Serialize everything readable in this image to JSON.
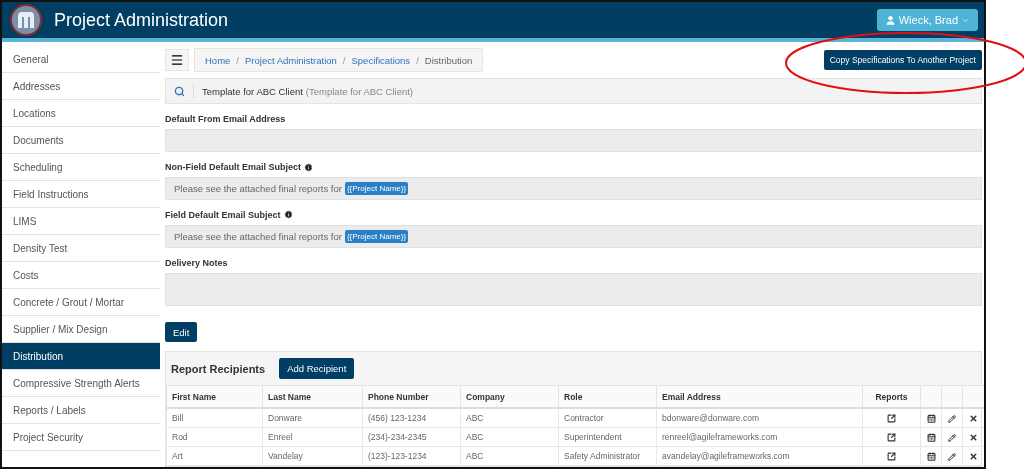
{
  "header": {
    "title": "Project Administration",
    "user_menu": "Wieck, Brad"
  },
  "sidebar": {
    "items": [
      {
        "label": "General",
        "selected": false
      },
      {
        "label": "Addresses",
        "selected": false
      },
      {
        "label": "Locations",
        "selected": false
      },
      {
        "label": "Documents",
        "selected": false
      },
      {
        "label": "Scheduling",
        "selected": false
      },
      {
        "label": "Field Instructions",
        "selected": false
      },
      {
        "label": "LIMS",
        "selected": false
      },
      {
        "label": "Density Test",
        "selected": false
      },
      {
        "label": "Costs",
        "selected": false
      },
      {
        "label": "Concrete / Grout / Mortar",
        "selected": false
      },
      {
        "label": "Supplier / Mix Design",
        "selected": false
      },
      {
        "label": "Distribution",
        "selected": true
      },
      {
        "label": "Compressive Strength Alerts",
        "selected": false
      },
      {
        "label": "Reports / Labels",
        "selected": false
      },
      {
        "label": "Project Security",
        "selected": false
      }
    ]
  },
  "breadcrumb": [
    "Home",
    "Project Administration",
    "Specifications",
    "Distribution"
  ],
  "breadcrumb_separator": "/",
  "copy_button": "Copy Specifications To Another Project",
  "template_selector": {
    "value": "Template for ABC Client",
    "detail": "(Template for ABC Client)"
  },
  "fields": [
    {
      "kind": "input",
      "label": "Default From Email Address",
      "info": false
    },
    {
      "kind": "input",
      "label": "Non-Field Default Email Subject",
      "info": true,
      "value": "Please see the attached final reports for",
      "token": "{{Project Name}}"
    },
    {
      "kind": "input",
      "label": "Field Default Email Subject",
      "info": true,
      "value": "Please see the attached final reports for",
      "token": "{{Project Name}}"
    },
    {
      "kind": "textarea",
      "label": "Delivery Notes",
      "info": false
    }
  ],
  "edit_button": "Edit",
  "recipients": {
    "title": "Report Recipients",
    "add_button": "Add Recipient",
    "columns": [
      "First Name",
      "Last Name",
      "Phone Number",
      "Company",
      "Role",
      "Email Address",
      "Reports"
    ],
    "rows": [
      [
        "Bill",
        "Donware",
        "(456) 123-1234",
        "ABC",
        "Contractor",
        "bdonware@donware.com"
      ],
      [
        "Rod",
        "Enreel",
        "(234)-234-2345",
        "ABC",
        "Superintendent",
        "renreel@agileframeworks.com"
      ],
      [
        "Art",
        "Vandelay",
        "(123)-123-1234",
        "ABC",
        "Safety Administrator",
        "avandelay@agileframeworks.com"
      ]
    ]
  }
}
